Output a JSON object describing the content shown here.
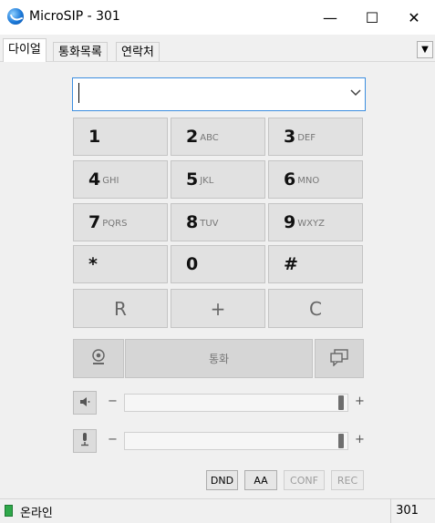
{
  "window": {
    "title": "MicroSIP - 301",
    "minimize": "—",
    "maximize": "☐",
    "close": "✕"
  },
  "tabs": [
    {
      "label": "다이얼",
      "active": true
    },
    {
      "label": "통화목록",
      "active": false
    },
    {
      "label": "연락처",
      "active": false
    }
  ],
  "tab_menu": "▼",
  "dialer": {
    "number_value": "",
    "dropdown_icon": "chevron-down-icon",
    "keys": [
      {
        "digit": "1",
        "letters": ""
      },
      {
        "digit": "2",
        "letters": "ABC"
      },
      {
        "digit": "3",
        "letters": "DEF"
      },
      {
        "digit": "4",
        "letters": "GHI"
      },
      {
        "digit": "5",
        "letters": "JKL"
      },
      {
        "digit": "6",
        "letters": "MNO"
      },
      {
        "digit": "7",
        "letters": "PQRS"
      },
      {
        "digit": "8",
        "letters": "TUV"
      },
      {
        "digit": "9",
        "letters": "WXYZ"
      },
      {
        "digit": "*",
        "letters": ""
      },
      {
        "digit": "0",
        "letters": ""
      },
      {
        "digit": "#",
        "letters": ""
      }
    ],
    "function_keys": [
      "R",
      "+",
      "C"
    ],
    "call_label": "통화",
    "minus": "−",
    "plus": "+",
    "speaker_level": 1.0,
    "mic_level": 1.0,
    "toggles": [
      {
        "label": "DND",
        "enabled": true
      },
      {
        "label": "AA",
        "enabled": true
      },
      {
        "label": "CONF",
        "enabled": false
      },
      {
        "label": "REC",
        "enabled": false
      }
    ]
  },
  "status": {
    "text": "온라인",
    "extension": "301"
  },
  "colors": {
    "accent": "#3c8ee0",
    "online": "#2fa84a"
  }
}
